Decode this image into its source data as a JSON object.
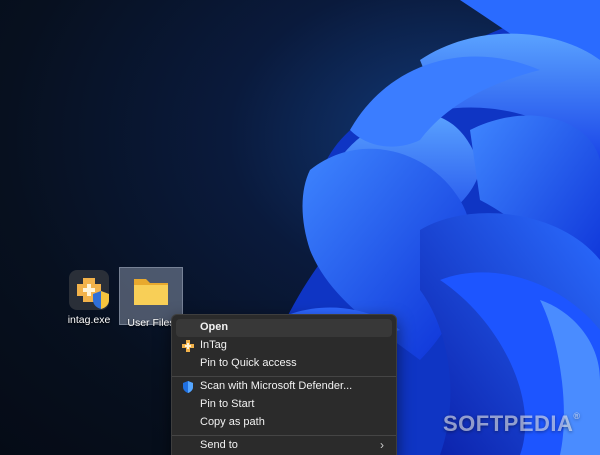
{
  "desktop": {
    "icons": [
      {
        "label": "intag.exe",
        "icon": "intag-app-icon"
      },
      {
        "label": "User Files",
        "icon": "folder-icon"
      }
    ]
  },
  "context_menu": {
    "items": [
      {
        "label": "Open",
        "icon": ""
      },
      {
        "label": "InTag",
        "icon": "intag-icon"
      },
      {
        "label": "Pin to Quick access",
        "icon": ""
      },
      {
        "label": "Scan with Microsoft Defender...",
        "icon": "defender-shield-icon"
      },
      {
        "label": "Pin to Start",
        "icon": ""
      },
      {
        "label": "Copy as path",
        "icon": ""
      },
      {
        "label": "Send to",
        "icon": "",
        "submenu_indicator": "›"
      }
    ]
  },
  "watermark": {
    "text": "SOFTPEDIA",
    "trademark": "®"
  },
  "colors": {
    "menu_bg": "#2b2b2b",
    "wallpaper_blue": "#1e5cff",
    "folder_yellow": "#f5c851"
  }
}
